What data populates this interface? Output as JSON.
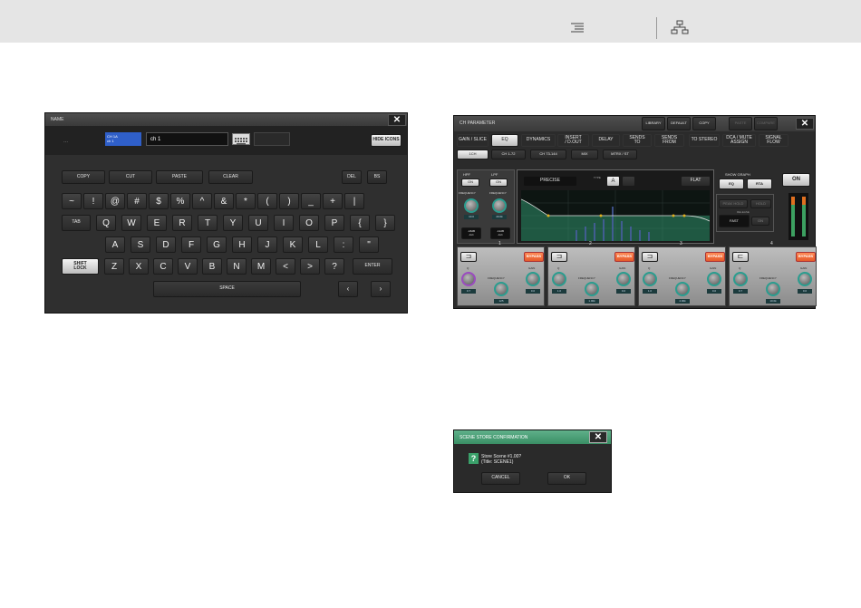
{
  "name_window": {
    "title": "NAME",
    "prev_name": "...",
    "ch_tag": "CH 1A\nch 1",
    "input_value": "ch 1",
    "hide_icons": "HIDE ICONS",
    "edit_keys": [
      "COPY",
      "CUT",
      "PASTE",
      "CLEAR"
    ],
    "del": "DEL",
    "bs": "BS",
    "row1": [
      "~",
      "!",
      "@",
      "#",
      "$",
      "%",
      "^",
      "&",
      "*",
      "(",
      ")",
      "_",
      "+",
      "|"
    ],
    "tab": "TAB",
    "row2": [
      "Q",
      "W",
      "E",
      "R",
      "T",
      "Y",
      "U",
      "I",
      "O",
      "P",
      "{",
      "}"
    ],
    "row3": [
      "A",
      "S",
      "D",
      "F",
      "G",
      "H",
      "J",
      "K",
      "L",
      ":",
      "\""
    ],
    "shift": "SHIFT\nLOCK",
    "row4": [
      "Z",
      "X",
      "C",
      "V",
      "B",
      "N",
      "M",
      "<",
      ">",
      "?"
    ],
    "enter": "ENTER",
    "space": "SPACE",
    "left": "‹",
    "right": "›"
  },
  "ch_param": {
    "title": "CH PARAMETER",
    "top_icons": [
      "LIBRARY",
      "DEFAULT",
      "COPY",
      "PASTE",
      "COMPARE"
    ],
    "tabs": [
      "GAIN / SLICE",
      "EQ",
      "DYNAMICS",
      "INSERT\n/ D.OUT",
      "DELAY",
      "SENDS\nTO",
      "SENDS\nFROM",
      "TO STEREO",
      "DCA / MUTE\nASSIGN",
      "SIGNAL\nFLOW"
    ],
    "subtabs": [
      "1CH",
      "CH 1-72",
      "CH 73-144",
      "MIX",
      "MTRX / ST"
    ],
    "hpf": "HPF",
    "lpf": "LPF",
    "on": "ON",
    "freq": "FREQUENCY",
    "hpf_freq": "10.0",
    "lpf_freq": "20.0k",
    "hpf_slope": "-18dB\n/oct",
    "lpf_slope": "-12dB\n/oct",
    "precise": "PRECISE",
    "type": "TYPE",
    "a": "A",
    "flat": "FLAT",
    "show_graph": "SHOW GRAPH",
    "eq": "EQ",
    "rta": "RTA",
    "peak_hold": "PEAK HOLD",
    "hold": "HOLD",
    "release": "RELEASE",
    "fast": "FAST",
    "on2": "ON",
    "bands": [
      {
        "num": "1",
        "q": "Q",
        "freq": "FREQUENCY",
        "gain": "GAIN",
        "bypass": "BYPASS",
        "qv": "0.7",
        "fv": "125",
        "gv": "0.0"
      },
      {
        "num": "2",
        "q": "Q",
        "freq": "FREQUENCY",
        "gain": "GAIN",
        "bypass": "BYPASS",
        "qv": "1.0",
        "fv": "1.00k",
        "gv": "0.0"
      },
      {
        "num": "3",
        "q": "Q",
        "freq": "FREQUENCY",
        "gain": "GAIN",
        "bypass": "BYPASS",
        "qv": "1.0",
        "fv": "4.00k",
        "gv": "0.0"
      },
      {
        "num": "4",
        "q": "Q",
        "freq": "FREQUENCY",
        "gain": "GAIN",
        "bypass": "BYPASS",
        "qv": "0.7",
        "fv": "10.0k",
        "gv": "0.0"
      }
    ]
  },
  "scene": {
    "title": "SCENE STORE CONFIRMATION",
    "q": "?",
    "line1": "Store Scene #1.00?",
    "line2": "(Title: SCENE1)",
    "cancel": "CANCEL",
    "ok": "OK"
  }
}
